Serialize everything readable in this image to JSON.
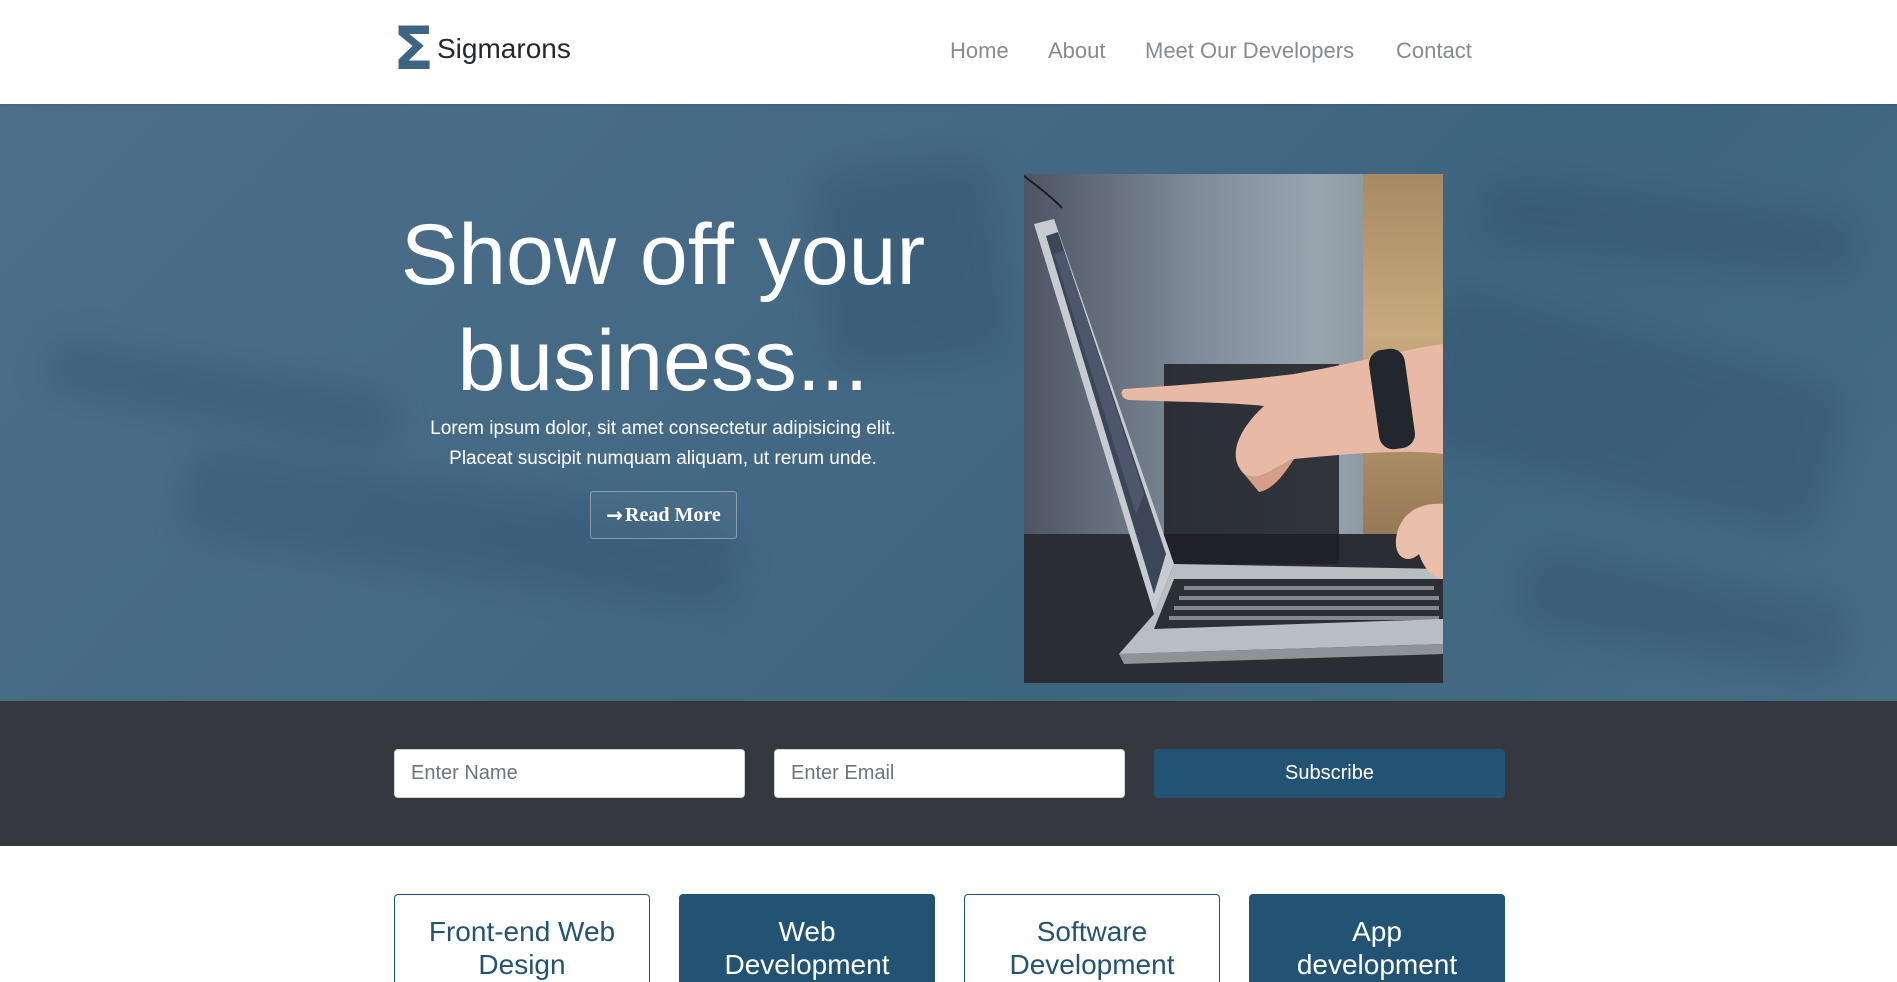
{
  "navbar": {
    "brand": {
      "icon": "sigma-icon",
      "symbol": "Σ",
      "name": "Sigmarons"
    },
    "links": [
      "Home",
      "About",
      "Meet Our Developers",
      "Contact"
    ]
  },
  "hero": {
    "title_line1": "Show off your",
    "title_line2": "business...",
    "text_line1": "Lorem ipsum dolor, sit amet consectetur adipisicing elit.",
    "text_line2": "Placeat suscipit numquam aliquam, ut rerum unde.",
    "button_label": "Read More",
    "button_icon": "arrow-right-icon"
  },
  "subscribe": {
    "name_placeholder": "Enter Name",
    "email_placeholder": "Enter Email",
    "button_label": "Subscribe"
  },
  "services": [
    {
      "line1": "Front-end Web",
      "line2": "Design",
      "style": "outline"
    },
    {
      "line1": "Web",
      "line2": "Development",
      "style": "filled"
    },
    {
      "line1": "Software",
      "line2": "Development",
      "style": "outline"
    },
    {
      "line1": "App",
      "line2": "development",
      "style": "filled"
    }
  ],
  "colors": {
    "brand_blue": "#235372",
    "hero_blue": "#456a86",
    "dark_bar": "#35393f",
    "nav_text": "#848b92"
  }
}
